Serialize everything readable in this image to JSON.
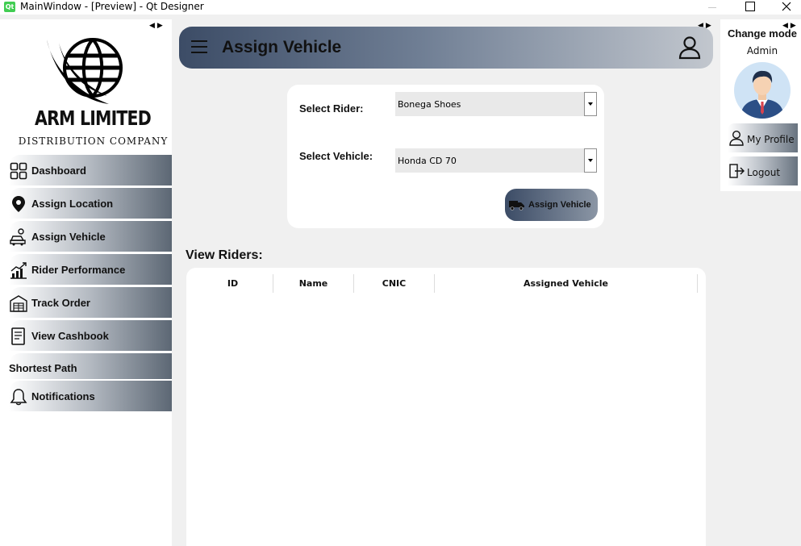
{
  "window": {
    "app_icon_text": "Qt",
    "title": "MainWindow - [Preview] - Qt Designer"
  },
  "sidebar": {
    "company_name": "ARM LIMITED",
    "company_subtitle": "DISTRIBUTION COMPANY",
    "items": [
      {
        "label": "Dashboard",
        "icon": "dashboard-grid-icon"
      },
      {
        "label": "Assign Location",
        "icon": "map-pin-icon"
      },
      {
        "label": "Assign Vehicle",
        "icon": "car-person-icon"
      },
      {
        "label": "Rider Performance",
        "icon": "performance-chart-icon"
      },
      {
        "label": "Track Order",
        "icon": "warehouse-icon"
      },
      {
        "label": "View Cashbook",
        "icon": "book-icon"
      },
      {
        "label": "Shortest Path",
        "icon": ""
      },
      {
        "label": "Notifications",
        "icon": "bell-icon"
      }
    ]
  },
  "header": {
    "title": "Assign Vehicle"
  },
  "form": {
    "rider_label": "Select Rider:",
    "rider_value": "Bonega Shoes",
    "vehicle_label": "Select Vehicle:",
    "vehicle_value": "Honda CD 70",
    "assign_button": "Assign Vehicle"
  },
  "riders": {
    "section_title": "View Riders:",
    "columns": [
      "ID",
      "Name",
      "CNIC",
      "Assigned Vehicle"
    ],
    "rows": []
  },
  "right_panel": {
    "change_mode": "Change mode",
    "role": "Admin",
    "profile_button": "My Profile",
    "logout_button": "Logout"
  },
  "colors": {
    "accent_dark": "#3c4c66",
    "accent_light": "#c2c7ce",
    "background": "#f0f0f0"
  }
}
